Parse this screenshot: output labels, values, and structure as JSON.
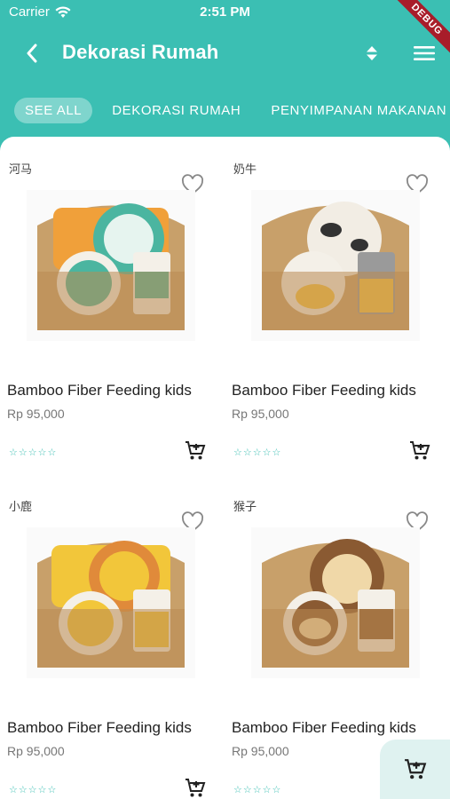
{
  "status": {
    "carrier": "Carrier",
    "time": "2:51 PM",
    "debug": "DEBUG"
  },
  "header": {
    "title": "Dekorasi Rumah",
    "back_icon": "chevron-left-icon",
    "sort_icon": "sort-icon",
    "menu_icon": "hamburger-menu-icon"
  },
  "tabs": [
    {
      "label": "SEE ALL",
      "active": true
    },
    {
      "label": "DEKORASI RUMAH",
      "active": false
    },
    {
      "label": "PENYIMPANAN MAKANAN",
      "active": false
    }
  ],
  "products": [
    {
      "tag": "河马",
      "name": "Bamboo Fiber Feeding kids",
      "price": "Rp 95,000",
      "rating": "☆☆☆☆☆",
      "theme": "hippo"
    },
    {
      "tag": "奶牛",
      "name": "Bamboo Fiber Feeding kids",
      "price": "Rp 95,000",
      "rating": "☆☆☆☆☆",
      "theme": "cow"
    },
    {
      "tag": "小鹿",
      "name": "Bamboo Fiber Feeding kids",
      "price": "Rp 95,000",
      "rating": "☆☆☆☆☆",
      "theme": "giraffe"
    },
    {
      "tag": "猴子",
      "name": "Bamboo Fiber Feeding kids",
      "price": "Rp 95,000",
      "rating": "☆☆☆☆☆",
      "theme": "monkey"
    }
  ],
  "colors": {
    "primary": "#3bbfb3",
    "fab_bg": "#dff2f0",
    "debug_ribbon": "#a81d2a"
  }
}
